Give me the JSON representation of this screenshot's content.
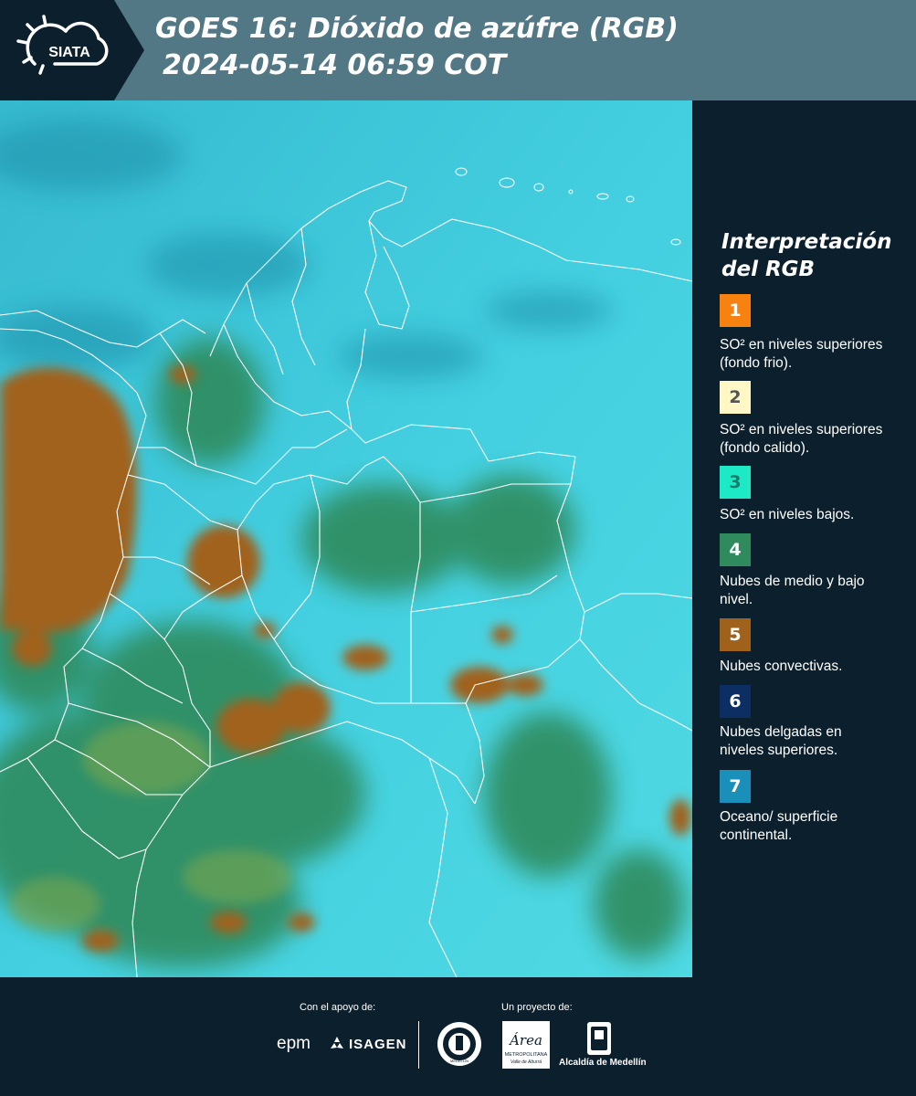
{
  "header": {
    "logo_text": "SIATA",
    "title_line1": "GOES 16: Dióxido de azúfre (RGB)",
    "title_line2": "2024-05-14 06:59 COT",
    "colors": {
      "header_bg": "#527785",
      "logo_panel": "#0c1f2d"
    }
  },
  "legend": {
    "title": "Interpretación del RGB",
    "items": [
      {
        "number": "1",
        "color": "#f7820f",
        "text_color": "#ffffff",
        "label": "SO² en niveles superiores (fondo frio)."
      },
      {
        "number": "2",
        "color": "#fff8c6",
        "text_color": "#555555",
        "label": "SO² en niveles superiores (fondo calido)."
      },
      {
        "number": "3",
        "color": "#1de9c7",
        "text_color": "#167c6c",
        "label": "SO² en niveles bajos."
      },
      {
        "number": "4",
        "color": "#2f8b5d",
        "text_color": "#ffffff",
        "label": "Nubes de medio y bajo nivel."
      },
      {
        "number": "5",
        "color": "#a0621b",
        "text_color": "#ffffff",
        "label": "Nubes convectivas."
      },
      {
        "number": "6",
        "color": "#0c2e63",
        "text_color": "#ffffff",
        "label": "Nubes delgadas en niveles superiores."
      },
      {
        "number": "7",
        "color": "#1a8fb9",
        "text_color": "#ffffff",
        "label": "Oceano/ superficie continental."
      }
    ]
  },
  "footer": {
    "support_label": "Con el apoyo de:",
    "project_label": "Un proyecto de:",
    "epm": "epm",
    "isagen": "ISAGEN",
    "seal_text": "MEDELLÍN",
    "metro_name": "Área",
    "metro_sub1": "METROPOLITANA",
    "metro_sub2": "Valle de Aburrá",
    "alcaldia": "Alcaldía de Medellín"
  },
  "map": {
    "colors": {
      "ocean": "#3cc8db",
      "mid_low_clouds": "#2f8b5d",
      "convective": "#a0621b",
      "borders": "#ffffff"
    }
  }
}
